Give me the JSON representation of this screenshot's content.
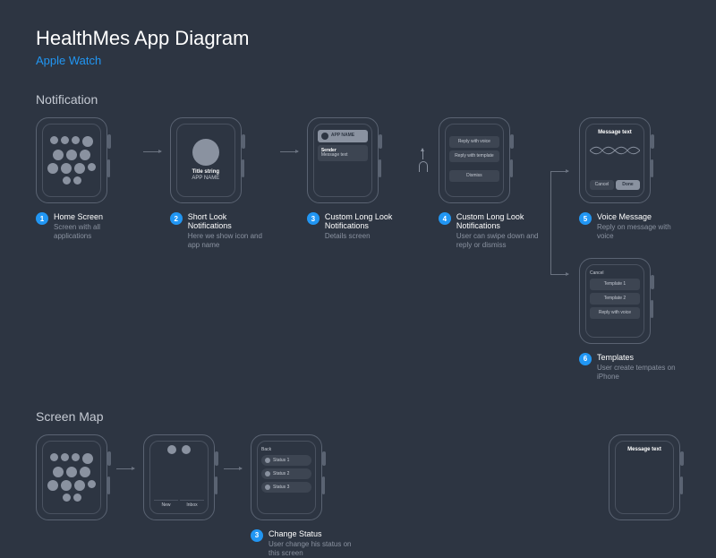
{
  "header": {
    "title": "HealthMes  App Diagram",
    "subtitle": "Apple Watch"
  },
  "sections": {
    "notification": "Notification",
    "screenmap": "Screen Map"
  },
  "notif": {
    "s1": {
      "num": "1",
      "title": "Home Screen",
      "text": "Screen with all applications"
    },
    "s2": {
      "num": "2",
      "title": "Short Look Notifications",
      "text": "Here we show icon and app name",
      "titleString": "Title string",
      "appName": "APP NAME"
    },
    "s3": {
      "num": "3",
      "title": "Custom Long Look Notifications",
      "text": "Details screen",
      "appLabel": "APP NAME",
      "sender": "Sender",
      "msg": "Message text"
    },
    "s4": {
      "num": "4",
      "title": "Custom Long Look Notifications",
      "text": "User can swipe down and reply or dismiss",
      "replyVoice": "Reply with voice",
      "replyTemplate": "Reply with template",
      "dismiss": "Dismiss"
    },
    "s5": {
      "num": "5",
      "title": "Voice Message",
      "text": "Reply on message with voice",
      "msgText": "Message text",
      "cancel": "Cancel",
      "done": "Done"
    },
    "s6": {
      "num": "6",
      "title": "Templates",
      "text": "User create tempates on iPhone",
      "cancel": "Cancel",
      "t1": "Template 1",
      "t2": "Template 2",
      "replyVoice": "Reply with voice"
    }
  },
  "map": {
    "s3": {
      "num": "3",
      "title": "Change Status",
      "text": "User change his status on this screen",
      "back": "Back",
      "st1": "Status 1",
      "st2": "Status 2",
      "st3": "Status 3"
    },
    "tabs": {
      "new": "New",
      "inbox": "Inbox"
    },
    "msgText": "Message text"
  }
}
